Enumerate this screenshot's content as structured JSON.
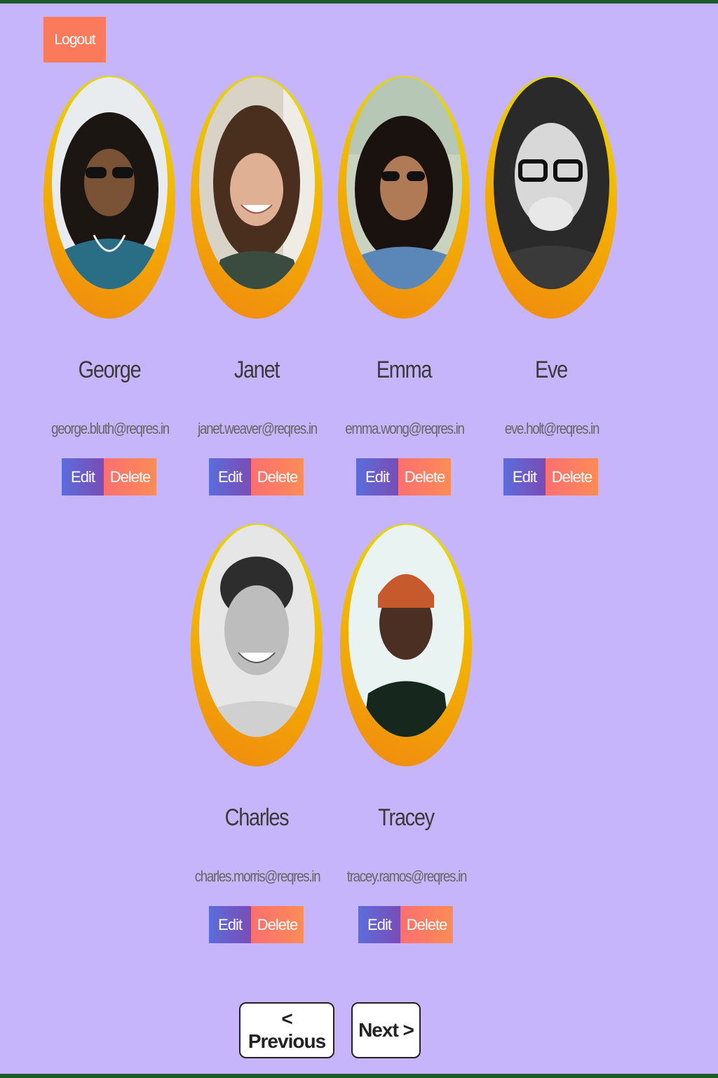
{
  "header": {
    "logout_label": "Logout"
  },
  "users": [
    {
      "name": "George",
      "email": "george.bluth@reqres.in"
    },
    {
      "name": "Janet",
      "email": "janet.weaver@reqres.in"
    },
    {
      "name": "Emma",
      "email": "emma.wong@reqres.in"
    },
    {
      "name": "Eve",
      "email": "eve.holt@reqres.in"
    },
    {
      "name": "Charles",
      "email": "charles.morris@reqres.in"
    },
    {
      "name": "Tracey",
      "email": "tracey.ramos@reqres.in"
    }
  ],
  "actions": {
    "edit_label": "Edit",
    "delete_label": "Delete"
  },
  "pagination": {
    "previous_label": "< Previous",
    "next_label": "Next >"
  },
  "colors": {
    "background": "#c6b5fa",
    "logout": "#fc7a5c",
    "edit_gradient": [
      "#5b6ddb",
      "#7a4cb5"
    ],
    "delete_gradient": [
      "#fc6f6f",
      "#fc8c56"
    ],
    "ring_gradient": [
      "#e3e000",
      "#f08a10"
    ],
    "frame": "#1c5a2c"
  }
}
